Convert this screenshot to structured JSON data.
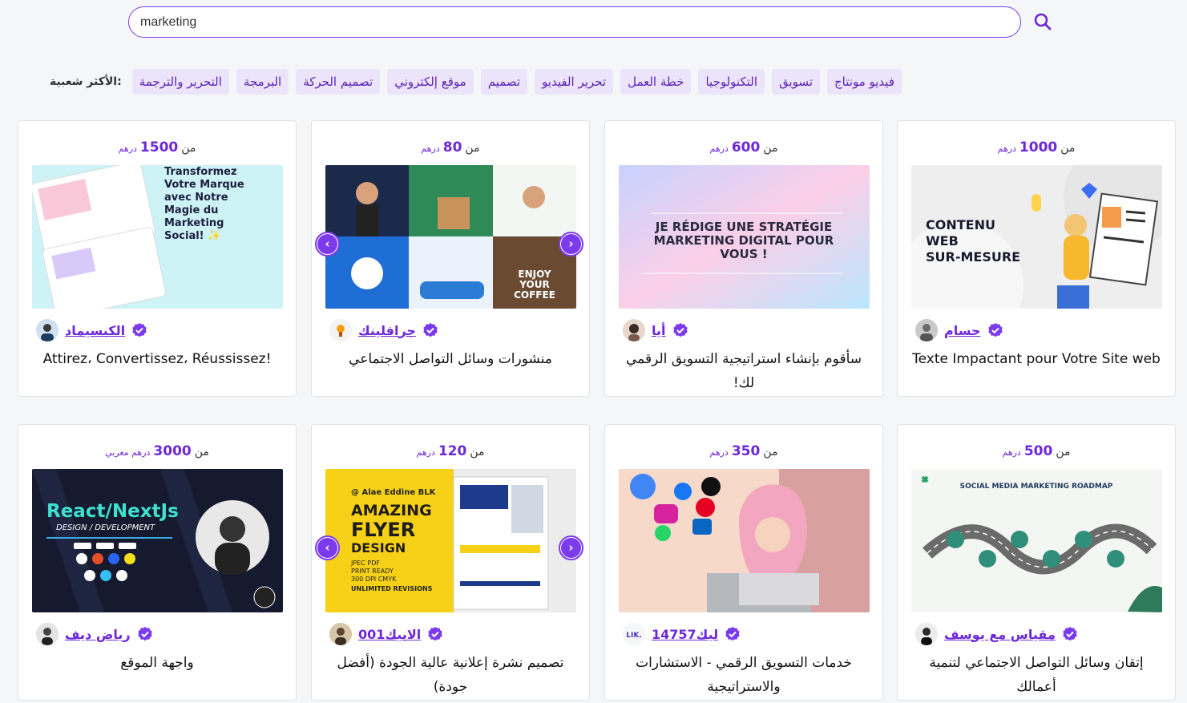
{
  "search": {
    "value": "marketing",
    "placeholder": ""
  },
  "popular": {
    "label": ":الأكثر شعبية",
    "tags": [
      "فيديو مونتاج",
      "تسويق",
      "التكنولوجيا",
      "خطة العمل",
      "تحرير الفيديو",
      "تصميم",
      "موقع إلكتروني",
      "تصميم الحركة",
      "البرمجة",
      "التحرير والترجمة"
    ]
  },
  "price_prefix": "من",
  "cards": [
    {
      "amount": "1000",
      "currency": "درهم",
      "seller": "حسام",
      "title": "Texte Impactant pour Votre Site web",
      "thumb_text": [
        "CONTENU",
        "WEB",
        "SUR-MESURE"
      ]
    },
    {
      "amount": "600",
      "currency": "درهم",
      "seller": "أيا",
      "title": "سأقوم بإنشاء استراتيجية التسويق الرقمي لك!",
      "thumb_text": [
        "JE RÉDIGE UNE STRATÉGIE",
        "MARKETING DIGITAL POUR",
        "VOUS !"
      ]
    },
    {
      "amount": "80",
      "currency": "درهم",
      "seller": "جرافلينك",
      "title": "منشورات وسائل التواصل الاجتماعي",
      "thumb_text": [
        "ENJOY",
        "YOUR",
        "COFFEE"
      ]
    },
    {
      "amount": "1500",
      "currency": "درهم",
      "seller": "الكبسيماد",
      "title": "Attirez، Convertissez، Réussissez!",
      "thumb_text": [
        "Transformez",
        "Votre Marque",
        "avec Notre",
        "Magie du",
        "Marketing",
        "Social! ✨"
      ]
    },
    {
      "amount": "500",
      "currency": "درهم",
      "seller": "مقياس مع يوسف",
      "title": "إتقان وسائل التواصل الاجتماعي لتنمية أعمالك",
      "thumb_text": [
        "SOCIAL MEDIA MARKETING ROADMAP"
      ]
    },
    {
      "amount": "350",
      "currency": "درهم",
      "seller": "ليك14757",
      "seller_prefix": "LIK.",
      "title": "خدمات التسويق الرقمي - الاستشارات والاستراتيجية",
      "thumb_text": []
    },
    {
      "amount": "120",
      "currency": "درهم",
      "seller": "الابيك001",
      "title": "تصميم نشرة إعلانية عالية الجودة (أفضل جودة)",
      "thumb_text": [
        "@ Alae Eddine BLK",
        "AMAZING",
        "FLYER",
        "DESIGN",
        "JPEC PDF",
        "PRINT READY",
        "300 DPI CMYK",
        "UNLIMITED REVISIONS"
      ]
    },
    {
      "amount": "3000",
      "currency": "درهم مغربي",
      "seller": "رياض ديف",
      "title": "واجهة الموقع",
      "thumb_text": [
        "React/NextJs",
        "DESIGN / DEVELOPMENT"
      ]
    }
  ],
  "colors": {
    "accent": "#7c3aed",
    "tag_bg": "#ebe4fb"
  }
}
